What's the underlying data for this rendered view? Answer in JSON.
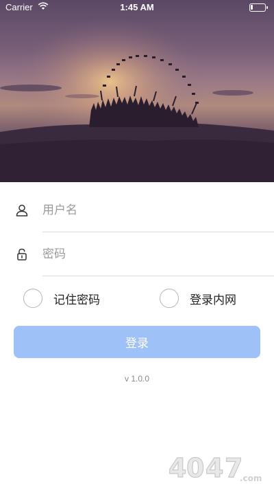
{
  "status_bar": {
    "carrier": "Carrier",
    "time": "1:45 AM"
  },
  "hero": {
    "icon": "graduation-silhouette-image"
  },
  "form": {
    "username_placeholder": "用户名",
    "password_placeholder": "密码",
    "username_icon": "user-icon",
    "password_icon": "lock-icon"
  },
  "options": {
    "remember_password": "记住密码",
    "intranet_login": "登录内网"
  },
  "login_button": {
    "label": "登录",
    "color": "#9ec1f7"
  },
  "version": "v 1.0.0",
  "watermark": {
    "text": "4047.com"
  }
}
